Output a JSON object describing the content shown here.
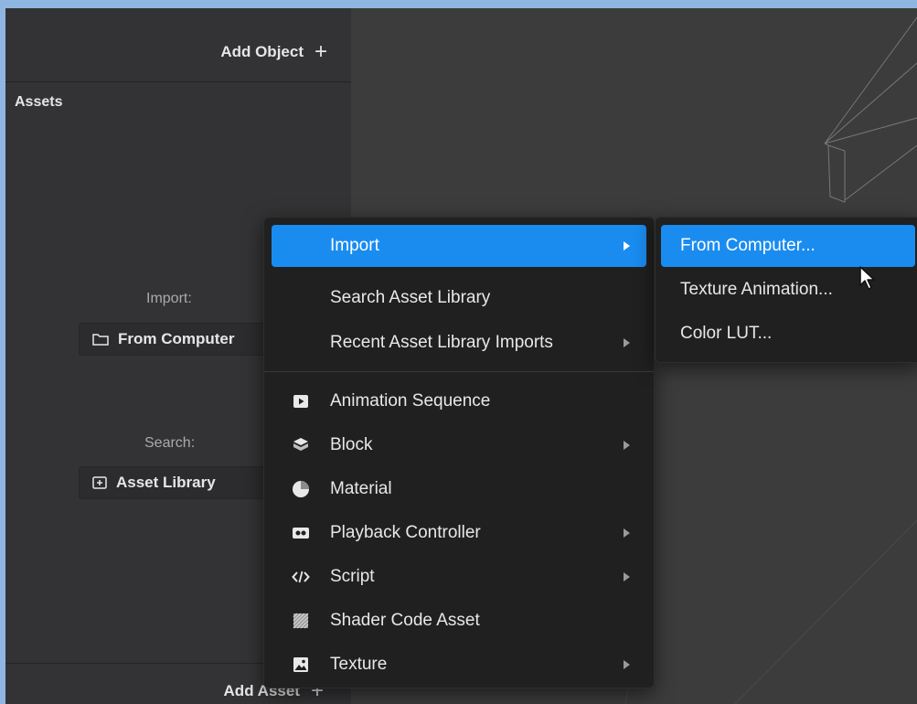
{
  "objects_panel": {
    "add_object_label": "Add Object"
  },
  "assets_panel": {
    "title": "Assets",
    "import_label": "Import:",
    "from_computer_label": "From Computer",
    "search_label": "Search:",
    "asset_library_label": "Asset Library",
    "add_asset_label": "Add Asset"
  },
  "context_menu": {
    "items": [
      {
        "label": "Import",
        "icon": "none",
        "has_submenu": true,
        "highlighted": true
      },
      {
        "label": "Search Asset Library",
        "icon": "none",
        "has_submenu": false
      },
      {
        "label": "Recent Asset Library Imports",
        "icon": "none",
        "has_submenu": true
      },
      {
        "label": "Animation Sequence",
        "icon": "play-square-icon",
        "has_submenu": false
      },
      {
        "label": "Block",
        "icon": "cube-icon",
        "has_submenu": true
      },
      {
        "label": "Material",
        "icon": "sphere-icon",
        "has_submenu": false
      },
      {
        "label": "Playback Controller",
        "icon": "controller-icon",
        "has_submenu": true
      },
      {
        "label": "Script",
        "icon": "code-icon",
        "has_submenu": true
      },
      {
        "label": "Shader Code Asset",
        "icon": "shader-icon",
        "has_submenu": false
      },
      {
        "label": "Texture",
        "icon": "image-icon",
        "has_submenu": true
      }
    ]
  },
  "import_submenu": {
    "items": [
      {
        "label": "From Computer...",
        "highlighted": true
      },
      {
        "label": "Texture Animation..."
      },
      {
        "label": "Color LUT..."
      }
    ]
  },
  "colors": {
    "accent": "#1a8cf0",
    "menu_bg": "#202020",
    "panel_bg": "#333335"
  }
}
